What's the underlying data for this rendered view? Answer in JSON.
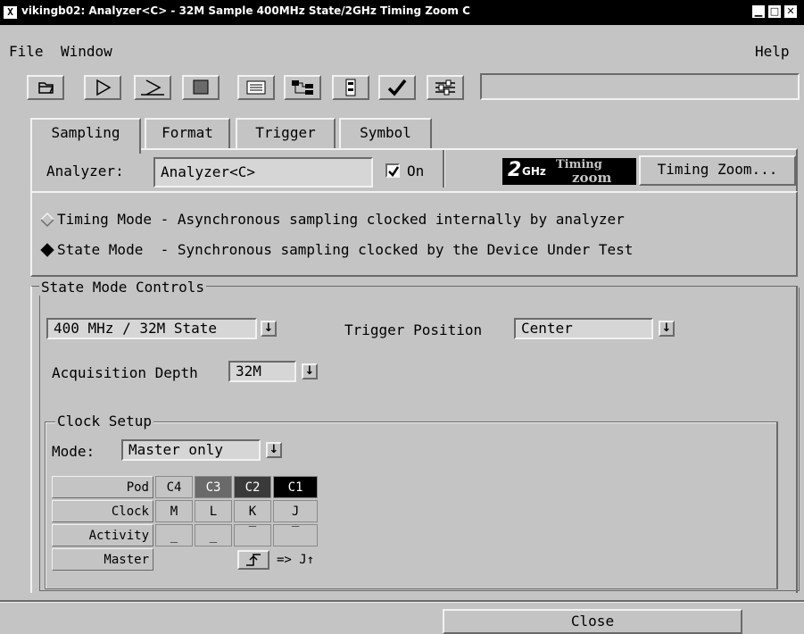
{
  "window": {
    "title": "vikingb02: Analyzer<C> - 32M Sample 400MHz State/2GHz Timing Zoom C",
    "x_icon": "X",
    "controls": [
      "minimize-icon",
      "maximize-icon",
      "close-icon"
    ]
  },
  "menu": {
    "file": "File",
    "window": "Window",
    "help": "Help"
  },
  "toolbar": {
    "buttons": [
      "open-folder-icon",
      "run-icon",
      "run-repetitive-icon",
      "stop-icon",
      "listing-icon",
      "hierarchy-icon",
      "device-icon",
      "check-icon",
      "settings-icon"
    ],
    "status_value": ""
  },
  "tabs": [
    "Sampling",
    "Format",
    "Trigger",
    "Symbol"
  ],
  "analyzer": {
    "label": "Analyzer:",
    "value": "Analyzer<C>",
    "on_label": "On",
    "on_checked": true
  },
  "timing_zoom": {
    "logo_main": "2",
    "logo_ghz": "GHz",
    "logo_top": "Timing",
    "logo_bottom": "zoom",
    "button": "Timing Zoom..."
  },
  "modes": {
    "timing": "Timing Mode - Asynchronous sampling clocked internally by analyzer",
    "state": "State Mode  - Synchronous sampling clocked by the Device Under Test",
    "selected": "state"
  },
  "state_controls": {
    "group_label": "State Mode Controls",
    "speed": "400 MHz / 32M State",
    "trigger_position_label": "Trigger Position",
    "trigger_position": "Center",
    "acq_depth_label": "Acquisition Depth",
    "acq_depth": "32M"
  },
  "clock_setup": {
    "group_label": "Clock Setup",
    "mode_label": "Mode:",
    "mode_value": "Master only",
    "rows": {
      "pod": {
        "label": "Pod",
        "cells": [
          "C4",
          "C3",
          "C2",
          "C1"
        ]
      },
      "clock": {
        "label": "Clock",
        "cells": [
          "M",
          "L",
          "K",
          "J"
        ]
      },
      "activity": {
        "label": "Activity",
        "cells": [
          "_",
          "_",
          "‾",
          "‾"
        ]
      },
      "master": {
        "label": "Master",
        "edge_icon": "rising-edge-icon",
        "result": "=> J↑"
      }
    }
  },
  "footer": {
    "close": "Close"
  },
  "colors": {
    "background": "#c4c4c4",
    "titlebar": "#000000",
    "field": "#d6d6d6"
  }
}
